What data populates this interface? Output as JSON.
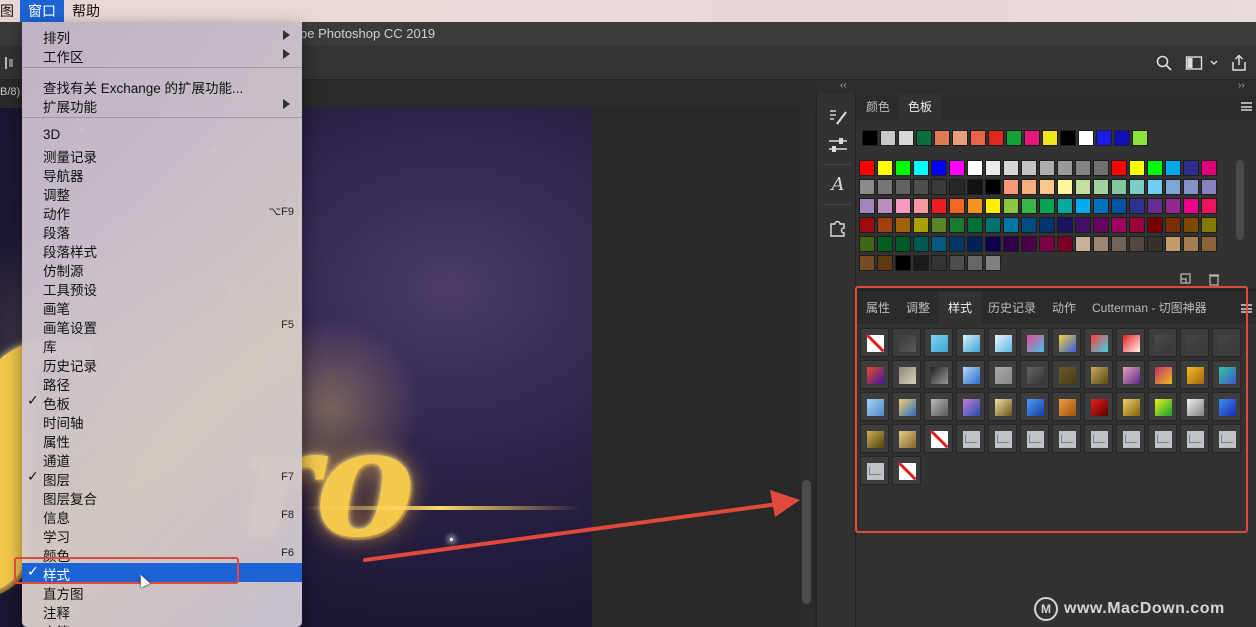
{
  "menubar": {
    "fragment": "图",
    "window_menu": "窗口",
    "help_menu": "帮助"
  },
  "titlebar": {
    "title": "pe Photoshop CC 2019"
  },
  "doc": {
    "tab_fragment": "B/8)"
  },
  "window_menu": {
    "items": [
      {
        "label": "排列",
        "submenu": true
      },
      {
        "label": "工作区",
        "submenu": true
      },
      {
        "label": "查找有关 Exchange 的扩展功能..."
      },
      {
        "label": "扩展功能",
        "submenu": true
      },
      {
        "label": "3D"
      },
      {
        "label": "测量记录"
      },
      {
        "label": "导航器"
      },
      {
        "label": "调整"
      },
      {
        "label": "动作",
        "shortcut": "⌥F9"
      },
      {
        "label": "段落"
      },
      {
        "label": "段落样式"
      },
      {
        "label": "仿制源"
      },
      {
        "label": "工具预设"
      },
      {
        "label": "画笔"
      },
      {
        "label": "画笔设置",
        "shortcut": "F5"
      },
      {
        "label": "库"
      },
      {
        "label": "历史记录"
      },
      {
        "label": "路径"
      },
      {
        "label": "色板",
        "checked": true
      },
      {
        "label": "时间轴"
      },
      {
        "label": "属性"
      },
      {
        "label": "通道"
      },
      {
        "label": "图层",
        "checked": true,
        "shortcut": "F7"
      },
      {
        "label": "图层复合"
      },
      {
        "label": "信息",
        "shortcut": "F8"
      },
      {
        "label": "学习"
      },
      {
        "label": "颜色",
        "shortcut": "F6"
      },
      {
        "label": "样式",
        "checked": true,
        "selected": true
      },
      {
        "label": "直方图"
      },
      {
        "label": "注释"
      },
      {
        "label": "字符"
      }
    ],
    "checkmark": "✓"
  },
  "swatches_panel": {
    "tabs": [
      {
        "label": "颜色"
      },
      {
        "label": "色板",
        "active": true
      }
    ],
    "recent": [
      "#000000",
      "#c8c8c8",
      "#d8d8d8",
      "#0a6e3c",
      "#e07a52",
      "#e8a07c",
      "#e8634a",
      "#e0261e",
      "#13a038",
      "#e4167c",
      "#f0e61e",
      "#000000",
      "#ffffff",
      "#1a1ae6",
      "#0f10b9",
      "#8ce23c"
    ],
    "grid": [
      "#ff0000",
      "#ffff00",
      "#00ff00",
      "#00ffff",
      "#0000ff",
      "#ff00ff",
      "#ffffff",
      "#ebebeb",
      "#d6d6d6",
      "#c2c2c2",
      "#adadad",
      "#999999",
      "#858585",
      "#707070",
      "#ff0000",
      "#ffff00",
      "#00ff00",
      "#00a8e8",
      "#2c2e8c",
      "#e0007c",
      "#8a8a8a",
      "#767676",
      "#626262",
      "#4e4e4e",
      "#3a3a3a",
      "#262626",
      "#121212",
      "#000000",
      "#f7977a",
      "#f9ad81",
      "#fdc68a",
      "#fff79a",
      "#c4df9b",
      "#a3d39c",
      "#82ca9d",
      "#7bcdc8",
      "#6ecff6",
      "#7ea7d8",
      "#8493ca",
      "#8882be",
      "#a187be",
      "#bc8dbf",
      "#f49ac2",
      "#f6989d",
      "#ed1c24",
      "#f26522",
      "#f7941d",
      "#fff200",
      "#8dc63f",
      "#39b54a",
      "#00a651",
      "#00a99d",
      "#00aeef",
      "#0072bc",
      "#0054a6",
      "#2e3192",
      "#662d91",
      "#92278f",
      "#ec008c",
      "#ed145b",
      "#9e0b0f",
      "#a0410d",
      "#a36209",
      "#aba000",
      "#598527",
      "#197b30",
      "#007236",
      "#00746b",
      "#0076a3",
      "#004b80",
      "#003471",
      "#1b1464",
      "#440e62",
      "#630460",
      "#9e005d",
      "#9e0039",
      "#790000",
      "#7b2e00",
      "#7d4900",
      "#827b00",
      "#406618",
      "#005e20",
      "#005826",
      "#005952",
      "#005b7f",
      "#003663",
      "#002157",
      "#0d004c",
      "#32004b",
      "#4b0049",
      "#7b0046",
      "#7a0026",
      "#c7b299",
      "#998675",
      "#736357",
      "#534741",
      "#37302d",
      "#c69c6d",
      "#a67c52",
      "#8c6239",
      "#754c24",
      "#603913",
      "#000000",
      "#1a1a1a",
      "#333333",
      "#4d4d4d",
      "#666666",
      "#808080"
    ]
  },
  "styles_panel": {
    "tabs": [
      {
        "label": "属性"
      },
      {
        "label": "调整"
      },
      {
        "label": "样式",
        "active": true
      },
      {
        "label": "历史记录"
      },
      {
        "label": "动作"
      },
      {
        "label": "Cutterman - 切图神器"
      }
    ],
    "styles": [
      {
        "kind": "none"
      },
      {
        "kind": "fill",
        "color": "#3a3a3a",
        "color2": "#5a5a5a"
      },
      {
        "kind": "fill",
        "color": "#7dd3ef",
        "color2": "#3aa5d6"
      },
      {
        "kind": "fill",
        "color": "#d9eef8",
        "color2": "#3aa5d6"
      },
      {
        "kind": "fill",
        "color": "#e8f4fb",
        "color2": "#5fb7e6"
      },
      {
        "kind": "fill",
        "color": "#e44a93",
        "color2": "#45c4e6"
      },
      {
        "kind": "fill",
        "color": "#f0d43a",
        "color2": "#3a55e6"
      },
      {
        "kind": "fill",
        "color": "#ff3a3a",
        "color2": "#3ad6e6"
      },
      {
        "kind": "fill",
        "color": "#e82020",
        "color2": "#fff0f0"
      },
      {
        "kind": "fill",
        "color": "#4a4a4a",
        "color2": "#383838"
      },
      {
        "kind": "fill",
        "color": "#444444",
        "color2": "#3a3a3a"
      },
      {
        "kind": "fill",
        "color": "#444444",
        "color2": "#3a3a3a"
      },
      {
        "kind": "fill",
        "color": "#e84a2a",
        "color2": "#3a1aa0"
      },
      {
        "kind": "fill",
        "color": "#8a8a7a",
        "color2": "#d8d0b8"
      },
      {
        "kind": "fill",
        "color": "#222222",
        "color2": "#9a9a9a"
      },
      {
        "kind": "fill",
        "color": "#b8d8f0",
        "color2": "#2a6ad0"
      },
      {
        "kind": "fill",
        "color": "#a8a8a8",
        "color2": "#888888"
      },
      {
        "kind": "fill",
        "color": "#666666",
        "color2": "#333333"
      },
      {
        "kind": "fill",
        "color": "#6a5a2a",
        "color2": "#4a3a1a"
      },
      {
        "kind": "fill",
        "color": "#c8a858",
        "color2": "#5a4818"
      },
      {
        "kind": "fill",
        "color": "#e8a0b8",
        "color2": "#5a2a8a"
      },
      {
        "kind": "fill",
        "color": "#c82a6a",
        "color2": "#e8c020"
      },
      {
        "kind": "fill",
        "color": "#f0c020",
        "color2": "#a86010"
      },
      {
        "kind": "fill",
        "color": "#3ac0a0",
        "color2": "#3a5ad0"
      },
      {
        "kind": "fill",
        "color": "#a8d0f0",
        "color2": "#4a8ad0"
      },
      {
        "kind": "fill",
        "color": "#f0d070",
        "color2": "#2a6ac0"
      },
      {
        "kind": "fill",
        "color": "#b8b8b8",
        "color2": "#5a5a5a"
      },
      {
        "kind": "fill",
        "color": "#c080d0",
        "color2": "#2a4ab0"
      },
      {
        "kind": "fill",
        "color": "#f0e0a0",
        "color2": "#6a5020"
      },
      {
        "kind": "fill",
        "color": "#4aa0f0",
        "color2": "#1a3ab0"
      },
      {
        "kind": "fill",
        "color": "#f0a040",
        "color2": "#a05010"
      },
      {
        "kind": "fill",
        "color": "#e02020",
        "color2": "#600000"
      },
      {
        "kind": "fill",
        "color": "#f0d060",
        "color2": "#806010"
      },
      {
        "kind": "fill",
        "color": "#f0f020",
        "color2": "#10a030"
      },
      {
        "kind": "fill",
        "color": "#f0f0f0",
        "color2": "#808080"
      },
      {
        "kind": "fill",
        "color": "#3a90f0",
        "color2": "#1a2ab0"
      },
      {
        "kind": "fill",
        "color": "#d0b050",
        "color2": "#504010"
      },
      {
        "kind": "fill",
        "color": "#e8d080",
        "color2": "#806030"
      },
      {
        "kind": "none"
      },
      {
        "kind": "env"
      },
      {
        "kind": "env"
      },
      {
        "kind": "env"
      },
      {
        "kind": "env"
      },
      {
        "kind": "env"
      },
      {
        "kind": "env"
      },
      {
        "kind": "env"
      },
      {
        "kind": "env"
      },
      {
        "kind": "env"
      },
      {
        "kind": "env"
      },
      {
        "kind": "none"
      }
    ]
  },
  "watermark": {
    "logo": "M",
    "text": "www.MacDown.com"
  },
  "colors": {
    "accent": "#1d63d3",
    "highlight": "#e0493c"
  }
}
